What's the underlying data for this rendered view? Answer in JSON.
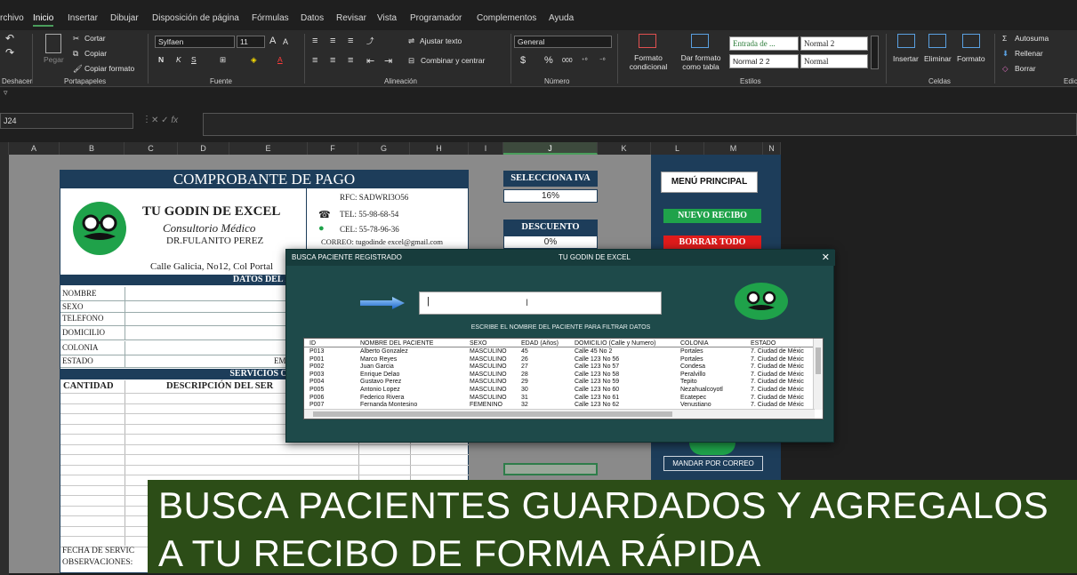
{
  "menu": [
    "rchivo",
    "Inicio",
    "Insertar",
    "Dibujar",
    "Disposición de página",
    "Fórmulas",
    "Datos",
    "Revisar",
    "Vista",
    "Programador",
    "Complementos",
    "Ayuda"
  ],
  "ribbon": {
    "groups": [
      "Deshacer",
      "Portapapeles",
      "Fuente",
      "Alineación",
      "Número",
      "Estilos",
      "Celdas",
      "Edic"
    ],
    "clipboard": {
      "cut": "Cortar",
      "copy": "Copiar",
      "format": "Copiar formato",
      "paste": "Pegar"
    },
    "font": {
      "name": "Sylfaen",
      "size": "11"
    },
    "alignment": {
      "wrap": "Ajustar texto",
      "merge": "Combinar y centrar"
    },
    "number": {
      "format": "General",
      "currency": "$",
      "percent": "%",
      "thousands": "000"
    },
    "styles": {
      "cond": "Formato condicional",
      "table": "Dar formato como tabla",
      "s1": "Entrada de ...",
      "s2": "Normal 2",
      "s3": "Normal 2 2",
      "s4": "Normal"
    },
    "cells": {
      "insert": "Insertar",
      "delete": "Eliminar",
      "format": "Formato"
    },
    "editing": {
      "autosum": "Autosuma",
      "fill": "Rellenar",
      "clear": "Borrar"
    }
  },
  "namebox": "J24",
  "fx": "fx",
  "columns": [
    "A",
    "B",
    "C",
    "D",
    "E",
    "F",
    "G",
    "H",
    "I",
    "J",
    "K",
    "L",
    "M",
    "N"
  ],
  "receipt": {
    "title": "COMPROBANTE DE PAGO",
    "business": "TU GODIN DE EXCEL",
    "subtitle": "Consultorio Médico",
    "doctor": "DR.FULANITO PEREZ",
    "address": "Calle Galicia, No12, Col Portal",
    "rfc": "RFC: SADWRI3O56",
    "tel": "TEL: 55-98-68-54",
    "cel": "CEL: 55-78-96-36",
    "email": "CORREO: tugodinde excel@gmail.com",
    "section_patient": "DATOS DEL PA",
    "fields": [
      "NOMBRE",
      "SEXO",
      "TELEFONO",
      "DOMICILIO",
      "COLONIA",
      "ESTADO"
    ],
    "estado_right": "EM",
    "section_services": "SERVICIOS OFR",
    "col_qty": "CANTIDAD",
    "col_desc": "DESCRIPCIÓN DEL SER",
    "footer_date": "FECHA DE SERVIC",
    "footer_obs": "OBSERVACIONES:"
  },
  "iva": {
    "label": "SELECCIONA IVA",
    "value": "16%"
  },
  "discount": {
    "label": "DESCUENTO",
    "value": "0%"
  },
  "side": {
    "menu": "MENÚ PRINCIPAL",
    "new": "NUEVO RECIBO",
    "clear": "BORRAR TODO",
    "mail": "MANDAR POR CORREO"
  },
  "dialog": {
    "title": "BUSCA PACIENTE REGISTRADO",
    "brand": "TU GODIN DE EXCEL",
    "close": "✕",
    "hint": "ESCRIBE EL NOMBRE DEL PACIENTE PARA FILTRAR DATOS",
    "columns": [
      "ID",
      "NOMBRE DEL PACIENTE",
      "SEXO",
      "EDAD (Años)",
      "DOMICILIO (Calle y Numero)",
      "COLONIA",
      "ESTADO"
    ],
    "rows": [
      [
        "P013",
        "Alberto Gonzalez",
        "MASCULINO",
        "45",
        "Calle 45 No 2",
        "Portales",
        "7. Ciudad de Méxic"
      ],
      [
        "P001",
        "Marco Reyes",
        "MASCULINO",
        "26",
        "Calle 123 No 56",
        "Portales",
        "7. Ciudad de Méxic"
      ],
      [
        "P002",
        "Juan Garcia",
        "MASCULINO",
        "27",
        "Calle 123 No 57",
        "Condesa",
        "7. Ciudad de Méxic"
      ],
      [
        "P003",
        "Enrique Delao",
        "MASCULINO",
        "28",
        "Calle 123 No 58",
        "Peralvillo",
        "7. Ciudad de Méxic"
      ],
      [
        "P004",
        "Gustavo Perez",
        "MASCULINO",
        "29",
        "Calle 123 No 59",
        "Tepito",
        "7. Ciudad de Méxic"
      ],
      [
        "P005",
        "Antonio Lopez",
        "MASCULINO",
        "30",
        "Calle 123 No 60",
        "Nezahualcoyotl",
        "7. Ciudad de Méxic"
      ],
      [
        "P006",
        "Federico Rivera",
        "MASCULINO",
        "31",
        "Calle 123 No 61",
        "Ecatepec",
        "7. Ciudad de Méxic"
      ],
      [
        "P007",
        "Fernanda Montesino",
        "FEMENINO",
        "32",
        "Calle 123 No 62",
        "Venustiano",
        "7. Ciudad de Méxic"
      ]
    ]
  },
  "banner": {
    "line1": "BUSCA PACIENTES GUARDADOS Y AGREGALOS",
    "line2": "A TU RECIBO DE FORMA RÁPIDA"
  },
  "colors": {
    "navy": "#1d3d5a",
    "green": "#1fa24a",
    "red": "#e01b1b",
    "dialog": "#1e4a4a",
    "banner": "#2c4d17"
  }
}
